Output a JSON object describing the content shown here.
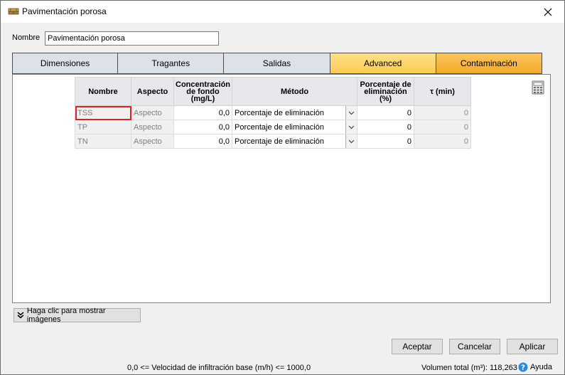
{
  "window": {
    "title": "Pavimentación porosa"
  },
  "name_field": {
    "label": "Nombre",
    "value": "Pavimentación porosa"
  },
  "tabs": [
    {
      "label": "Dimensiones"
    },
    {
      "label": "Tragantes"
    },
    {
      "label": "Salidas"
    },
    {
      "label": "Advanced"
    },
    {
      "label": "Contaminación"
    }
  ],
  "active_tab": "Contaminación",
  "grid": {
    "headers": {
      "nombre": "Nombre",
      "aspecto": "Aspecto",
      "conc": "Concentración de fondo (mg/L)",
      "metodo": "Método",
      "porc": "Porcentaje de eliminación (%)",
      "tau": "τ (min)"
    },
    "rows": [
      {
        "nombre": "TSS",
        "aspecto": "Aspecto",
        "conc": "0,0",
        "metodo": "Porcentaje de eliminación",
        "porc": "0",
        "tau": "0"
      },
      {
        "nombre": "TP",
        "aspecto": "Aspecto",
        "conc": "0,0",
        "metodo": "Porcentaje de eliminación",
        "porc": "0",
        "tau": "0"
      },
      {
        "nombre": "TN",
        "aspecto": "Aspecto",
        "conc": "0,0",
        "metodo": "Porcentaje de eliminación",
        "porc": "0",
        "tau": "0"
      }
    ]
  },
  "images_button": "Haga clic para mostrar imágenes",
  "buttons": {
    "ok": "Aceptar",
    "cancel": "Cancelar",
    "apply": "Aplicar"
  },
  "status": {
    "constraint": "0,0 <= Velocidad de infiltración base (m/h) <= 1000,0",
    "volume": "Volumen total (m³):  118,263",
    "help": "Ayuda"
  },
  "colors": {
    "active_tab": "#f4a92a",
    "advanced_tab": "#fbcc54",
    "selection": "#e02020"
  }
}
